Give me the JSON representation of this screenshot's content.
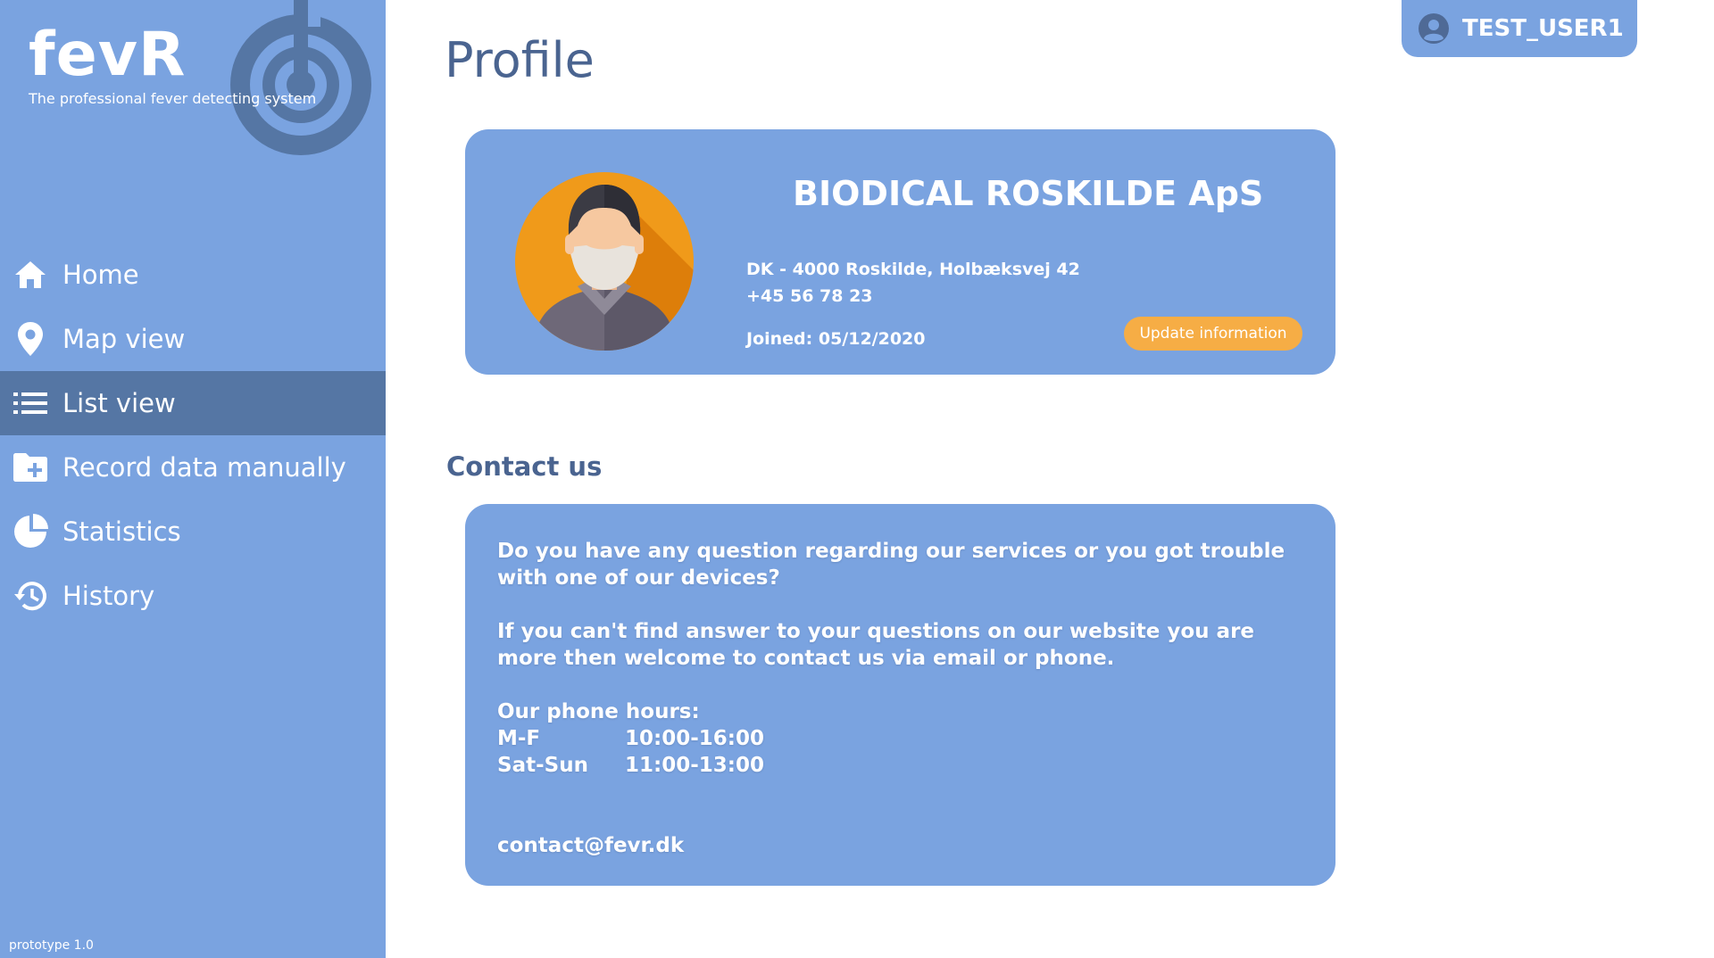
{
  "brand": {
    "name": "fevR",
    "tagline": "The professional fever detecting system"
  },
  "sidebar": {
    "items": [
      {
        "label": "Home",
        "icon": "home-icon"
      },
      {
        "label": "Map view",
        "icon": "map-pin-icon"
      },
      {
        "label": "List view",
        "icon": "list-icon",
        "active": true
      },
      {
        "label": "Record data manually",
        "icon": "folder-plus-icon"
      },
      {
        "label": "Statistics",
        "icon": "pie-chart-icon"
      },
      {
        "label": "History",
        "icon": "history-icon"
      }
    ],
    "version": "prototype 1.0"
  },
  "header": {
    "title": "Profile",
    "user": "TEST_USER1"
  },
  "profile": {
    "company": "BIODICAL ROSKILDE ApS",
    "address": "DK - 4000 Roskilde, Holbæksvej 42",
    "phone": "+45 56 78 23",
    "joined": "Joined: 05/12/2020",
    "update_label": "Update information"
  },
  "contact": {
    "title": "Contact us",
    "question": "Do you have any question regarding our services or you got trouble with one of our devices?",
    "website_note": "If you can't find answer to your questions on our website you are more then welcome to contact us via email or phone.",
    "hours_title": "Our phone hours:",
    "hours": [
      {
        "day": "M-F",
        "time": "10:00-16:00"
      },
      {
        "day": "Sat-Sun",
        "time": "11:00-13:00"
      }
    ],
    "email": "contact@fevr.dk"
  },
  "colors": {
    "sidebar": "#7aa3e0",
    "active": "#5576a4",
    "title": "#4a6490",
    "button": "#f6ad45"
  }
}
